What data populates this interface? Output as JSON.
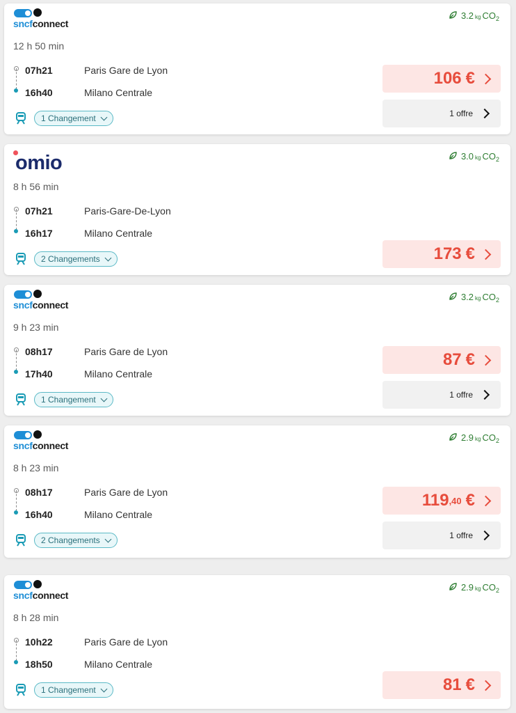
{
  "colors": {
    "price_text": "#e74c3c",
    "price_bg": "#fde6e4",
    "co2_green": "#2e7d32",
    "change_teal": "#2a6f7a",
    "sncf_blue": "#1e8ed6",
    "omio_navy": "#1b2b6b"
  },
  "results": [
    {
      "provider": "sncf",
      "logo_text_a": "sncf",
      "logo_text_b": "connect",
      "co2_value": "3.2",
      "co2_unit": "kg",
      "co2_label": "CO",
      "co2_sub": "2",
      "duration": "12 h 50 min",
      "dep_time": "07h21",
      "dep_station": "Paris Gare de Lyon",
      "arr_time": "16h40",
      "arr_station": "Milano Centrale",
      "changes": "1 Changement",
      "price_main": "106",
      "price_cents": "",
      "currency": "€",
      "offers": "1 offre"
    },
    {
      "provider": "omio",
      "logo_text": "omio",
      "co2_value": "3.0",
      "co2_unit": "kg",
      "co2_label": "CO",
      "co2_sub": "2",
      "duration": "8 h 56 min",
      "dep_time": "07h21",
      "dep_station": "Paris-Gare-De-Lyon",
      "arr_time": "16h17",
      "arr_station": "Milano Centrale",
      "changes": "2 Changements",
      "price_main": "173",
      "price_cents": "",
      "currency": "€"
    },
    {
      "provider": "sncf",
      "logo_text_a": "sncf",
      "logo_text_b": "connect",
      "co2_value": "3.2",
      "co2_unit": "kg",
      "co2_label": "CO",
      "co2_sub": "2",
      "duration": "9 h 23 min",
      "dep_time": "08h17",
      "dep_station": "Paris Gare de Lyon",
      "arr_time": "17h40",
      "arr_station": "Milano Centrale",
      "changes": "1 Changement",
      "price_main": "87",
      "price_cents": "",
      "currency": "€",
      "offers": "1 offre"
    },
    {
      "provider": "sncf",
      "logo_text_a": "sncf",
      "logo_text_b": "connect",
      "co2_value": "2.9",
      "co2_unit": "kg",
      "co2_label": "CO",
      "co2_sub": "2",
      "duration": "8 h 23 min",
      "dep_time": "08h17",
      "dep_station": "Paris Gare de Lyon",
      "arr_time": "16h40",
      "arr_station": "Milano Centrale",
      "changes": "2 Changements",
      "price_main": "119",
      "price_cents": ",40",
      "currency": "€",
      "offers": "1 offre"
    },
    {
      "provider": "sncf",
      "logo_text_a": "sncf",
      "logo_text_b": "connect",
      "co2_value": "2.9",
      "co2_unit": "kg",
      "co2_label": "CO",
      "co2_sub": "2",
      "duration": "8 h 28 min",
      "dep_time": "10h22",
      "dep_station": "Paris Gare de Lyon",
      "arr_time": "18h50",
      "arr_station": "Milano Centrale",
      "changes": "1 Changement",
      "price_main": "81",
      "price_cents": "",
      "currency": "€"
    }
  ]
}
